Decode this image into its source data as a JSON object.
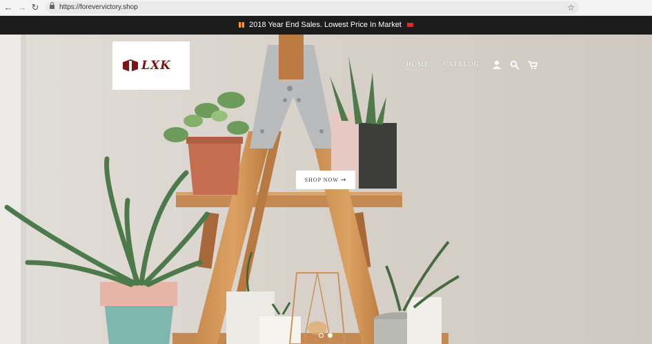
{
  "browser": {
    "url": "https://forevervictory.shop",
    "back_icon": "arrow-left-icon",
    "forward_icon": "arrow-right-icon",
    "reload_icon": "reload-icon",
    "star_icon": "star-icon"
  },
  "announcement": {
    "text": "2018 Year End Sales. Lowest Price In Market"
  },
  "header": {
    "logo_text": "LXK",
    "nav": [
      {
        "label": "HOME"
      },
      {
        "label": "CATALOG"
      }
    ],
    "icons": [
      "account-icon",
      "search-icon",
      "cart-icon"
    ]
  },
  "hero": {
    "cta_label": "SHOP NOW",
    "slide_count": 2,
    "active_slide": 2
  },
  "colors": {
    "announcement_bg": "#1c1c1c",
    "logo_red": "#7a1515"
  }
}
